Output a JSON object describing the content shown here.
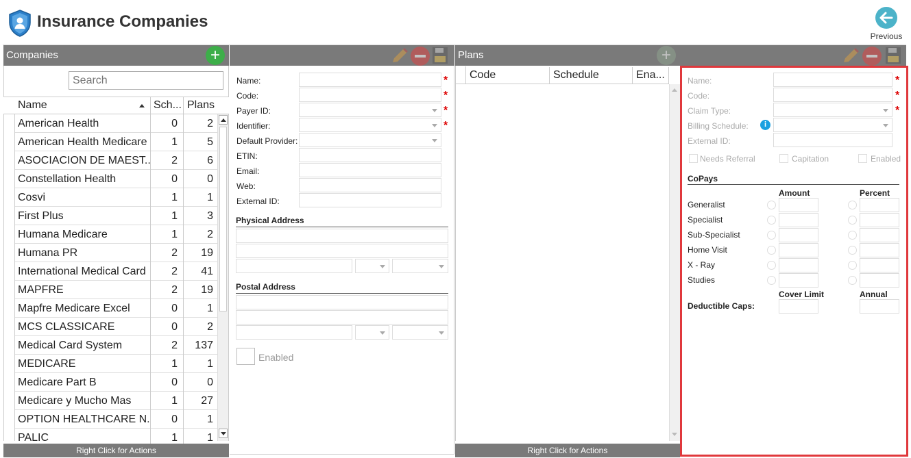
{
  "header": {
    "title": "Insurance Companies",
    "previous_label": "Previous",
    "accent": "#4cb3c9"
  },
  "companies": {
    "title": "Companies",
    "search_placeholder": "Search",
    "columns": [
      "Name",
      "Sch...",
      "Plans"
    ],
    "rows": [
      {
        "name": "American Health",
        "sch": "0",
        "plans": "2"
      },
      {
        "name": "American Health Medicare",
        "sch": "1",
        "plans": "5"
      },
      {
        "name": "ASOCIACION DE MAEST...",
        "sch": "2",
        "plans": "6"
      },
      {
        "name": "Constellation Health",
        "sch": "0",
        "plans": "0"
      },
      {
        "name": "Cosvi",
        "sch": "1",
        "plans": "1"
      },
      {
        "name": "First Plus",
        "sch": "1",
        "plans": "3"
      },
      {
        "name": "Humana Medicare",
        "sch": "1",
        "plans": "2"
      },
      {
        "name": "Humana PR",
        "sch": "2",
        "plans": "19"
      },
      {
        "name": "International Medical Card",
        "sch": "2",
        "plans": "41"
      },
      {
        "name": "MAPFRE",
        "sch": "2",
        "plans": "19"
      },
      {
        "name": "Mapfre Medicare Excel",
        "sch": "0",
        "plans": "1"
      },
      {
        "name": "MCS CLASSICARE",
        "sch": "0",
        "plans": "2"
      },
      {
        "name": "Medical Card System",
        "sch": "2",
        "plans": "137"
      },
      {
        "name": "MEDICARE",
        "sch": "1",
        "plans": "1"
      },
      {
        "name": "Medicare Part B",
        "sch": "0",
        "plans": "0"
      },
      {
        "name": "Medicare y Mucho Mas",
        "sch": "1",
        "plans": "27"
      },
      {
        "name": "OPTION HEALTHCARE N...",
        "sch": "0",
        "plans": "1"
      },
      {
        "name": "PALIC",
        "sch": "1",
        "plans": "1"
      }
    ],
    "footer": "Right Click for Actions"
  },
  "company_form": {
    "fields": [
      "Name:",
      "Code:",
      "Payer ID:",
      "Identifier:",
      "Default Provider:",
      "ETIN:",
      "Email:",
      "Web:",
      "External ID:"
    ],
    "physical_address": "Physical Address",
    "postal_address": "Postal Address",
    "enabled_label": "Enabled"
  },
  "plans": {
    "title": "Plans",
    "columns": [
      "Code",
      "Schedule",
      "Ena..."
    ],
    "footer": "Right Click for Actions"
  },
  "plan_form": {
    "fields": [
      "Name:",
      "Code:",
      "Claim Type:",
      "Billing Schedule:",
      "External ID:"
    ],
    "checks": [
      "Needs Referral",
      "Capitation",
      "Enabled"
    ],
    "copays_title": "CoPays",
    "amount_label": "Amount",
    "percent_label": "Percent",
    "copay_rows": [
      "Generalist",
      "Specialist",
      "Sub-Specialist",
      "Home Visit",
      "X - Ray",
      "Studies"
    ],
    "cover_limit_label": "Cover Limit",
    "annual_label": "Annual",
    "deductible_label": "Deductible Caps:"
  }
}
